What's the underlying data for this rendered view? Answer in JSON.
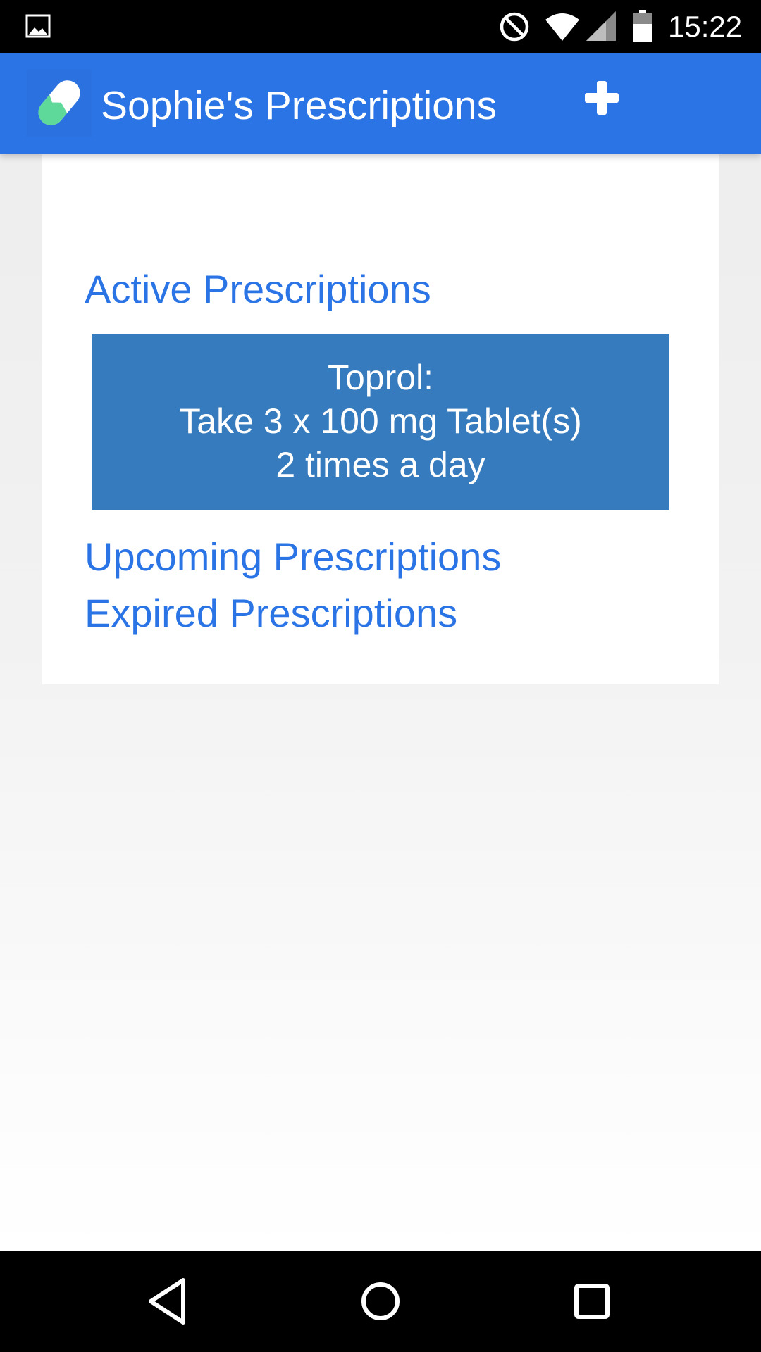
{
  "status_bar": {
    "time": "15:22",
    "icons": [
      "gallery-icon",
      "do-not-disturb-icon",
      "wifi-icon",
      "cell-signal-icon",
      "battery-icon"
    ]
  },
  "app_bar": {
    "title": "Sophie's Prescriptions",
    "logo_icon": "pill-capsule-icon",
    "add_icon": "plus-icon",
    "background_color": "#2a74e6"
  },
  "sections": {
    "active_label": "Active Prescriptions",
    "upcoming_label": "Upcoming Prescriptions",
    "expired_label": "Expired Prescriptions",
    "link_color": "#2a74e6"
  },
  "active_prescriptions": [
    {
      "name_line": "Toprol:",
      "dose_line": "Take 3 x 100 mg Tablet(s)",
      "frequency_line": "2 times a day",
      "background_color": "#367bbd"
    }
  ],
  "nav_bar": {
    "icons": [
      "back-icon",
      "home-icon",
      "recents-icon"
    ]
  }
}
